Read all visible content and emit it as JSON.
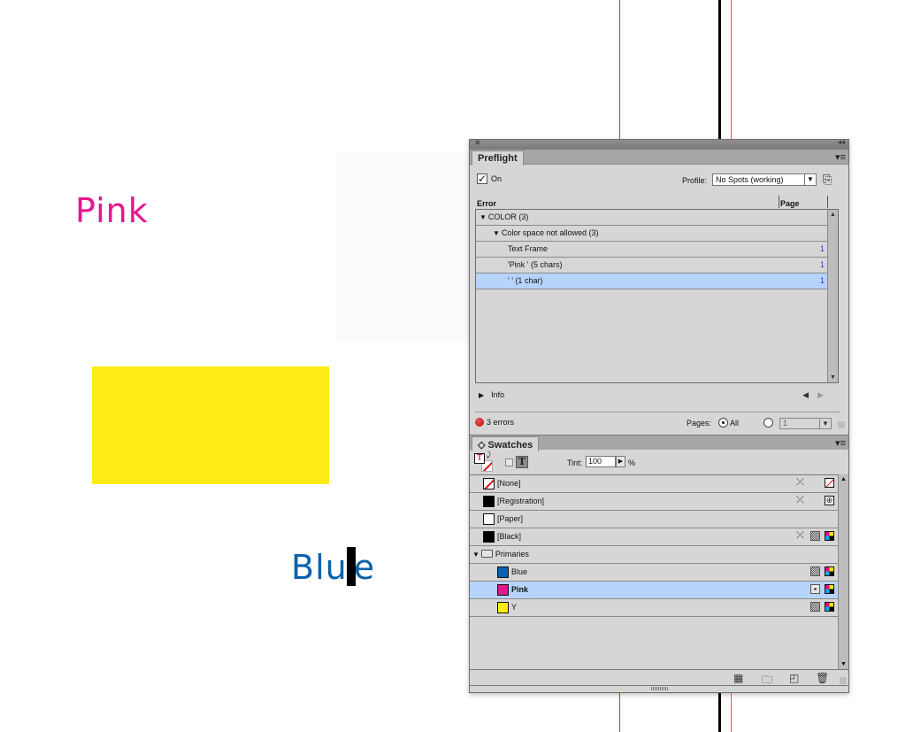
{
  "canvas": {
    "pink_text": "Pink",
    "blue_text_before_cursor": "Blu",
    "blue_text_after_cursor": "e",
    "colors": {
      "pink": "#e3178e",
      "yellow": "#ffec17",
      "blue": "#0a62ad"
    }
  },
  "preflight": {
    "tab_label": "Preflight",
    "on_label": "On",
    "on_checked": true,
    "profile_label": "Profile:",
    "profile_value": "No Spots (working)",
    "columns": {
      "error": "Error",
      "page": "Page"
    },
    "rows": [
      {
        "label": "COLOR (3)",
        "level": 0,
        "expanded": true,
        "page": ""
      },
      {
        "label": "Color space not allowed (3)",
        "level": 1,
        "expanded": true,
        "page": ""
      },
      {
        "label": "Text Frame",
        "level": 2,
        "page": "1"
      },
      {
        "label": "'Pink ' (5 chars)",
        "level": 2,
        "page": "1"
      },
      {
        "label": "' ' (1 char)",
        "level": 2,
        "page": "1",
        "selected": true
      }
    ],
    "info_label": "Info",
    "errors_label": "3 errors",
    "pages_label": "Pages:",
    "pages_all_label": "All",
    "pages_range_value": "1"
  },
  "swatches": {
    "tab_label": "Swatches",
    "tint_label": "Tint:",
    "tint_value": "100",
    "tint_unit": "%",
    "items": [
      {
        "name": "[None]",
        "chip": "none",
        "indent": 0
      },
      {
        "name": "[Registration]",
        "chip": "#000000",
        "indent": 0
      },
      {
        "name": "[Paper]",
        "chip": "#ffffff",
        "indent": 0
      },
      {
        "name": "[Black]",
        "chip": "#000000",
        "indent": 0
      },
      {
        "name": "Primaries",
        "chip": "folder",
        "indent": 0
      },
      {
        "name": "Blue",
        "chip": "#0a62ad",
        "indent": 1
      },
      {
        "name": "Pink",
        "chip": "#e3178e",
        "indent": 1,
        "selected": true
      },
      {
        "name": "Y",
        "chip": "#ffec17",
        "indent": 1
      }
    ]
  }
}
